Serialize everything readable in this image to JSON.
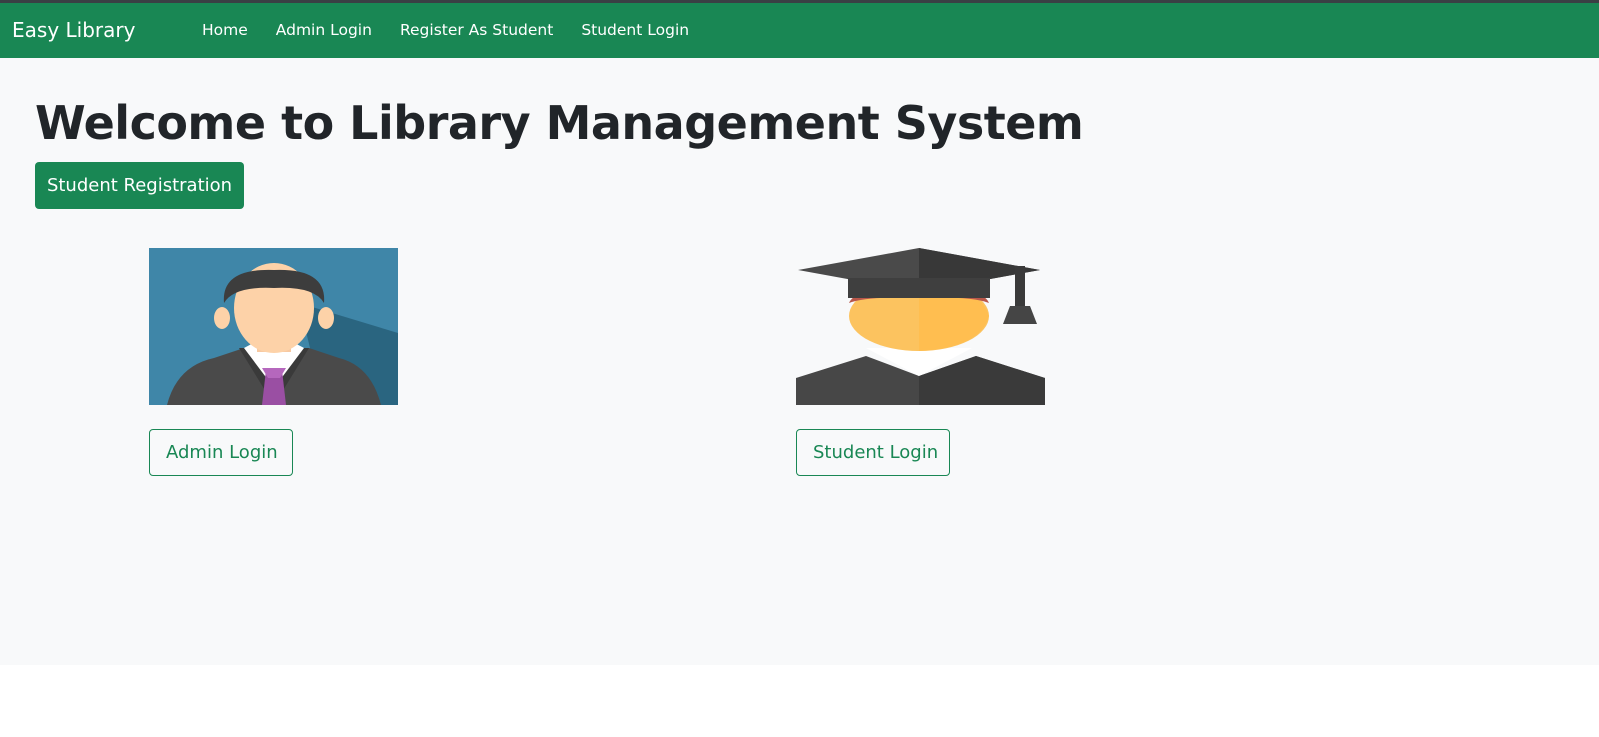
{
  "navbar": {
    "brand": "Easy Library",
    "links": [
      "Home",
      "Admin Login",
      "Register As Student",
      "Student Login"
    ],
    "color": "#198754"
  },
  "main": {
    "title": "Welcome to Library Management System",
    "register_button": "Student Registration",
    "cards": [
      {
        "image_icon": "admin-avatar-icon",
        "button": "Admin Login"
      },
      {
        "image_icon": "graduate-avatar-icon",
        "button": "Student Login"
      }
    ]
  }
}
